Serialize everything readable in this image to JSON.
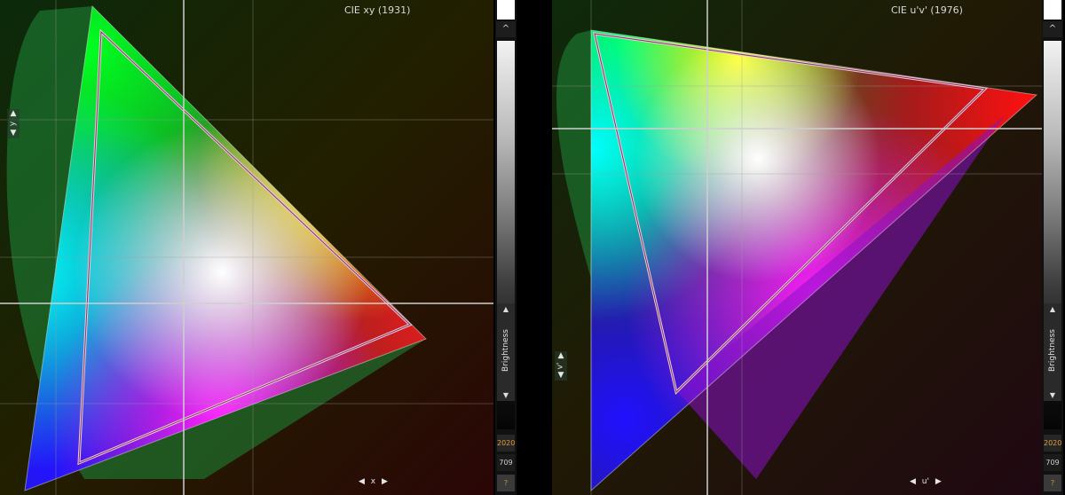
{
  "panels": [
    {
      "title": "CIE xy (1931)",
      "y_axis_label": "y",
      "x_axis_label": "x"
    },
    {
      "title": "CIE u'v' (1976)",
      "y_axis_label": "v'",
      "x_axis_label": "u'"
    }
  ],
  "controls": {
    "up_arrow": "▲",
    "down_arrow": "▼",
    "left_arrow": "◀",
    "right_arrow": "▶",
    "scroll_up": "^",
    "brightness_label": "Brightness",
    "gamut_2020": "2020",
    "gamut_709": "709",
    "help": "?"
  },
  "colors": {
    "background": "#000000",
    "gamut_outline": "#f0c8e0",
    "crosshair": "#cfcfcf",
    "active_gamut": "#e09a3a",
    "help_text": "#d8922e",
    "locus_fill": "#1e8a3a"
  }
}
